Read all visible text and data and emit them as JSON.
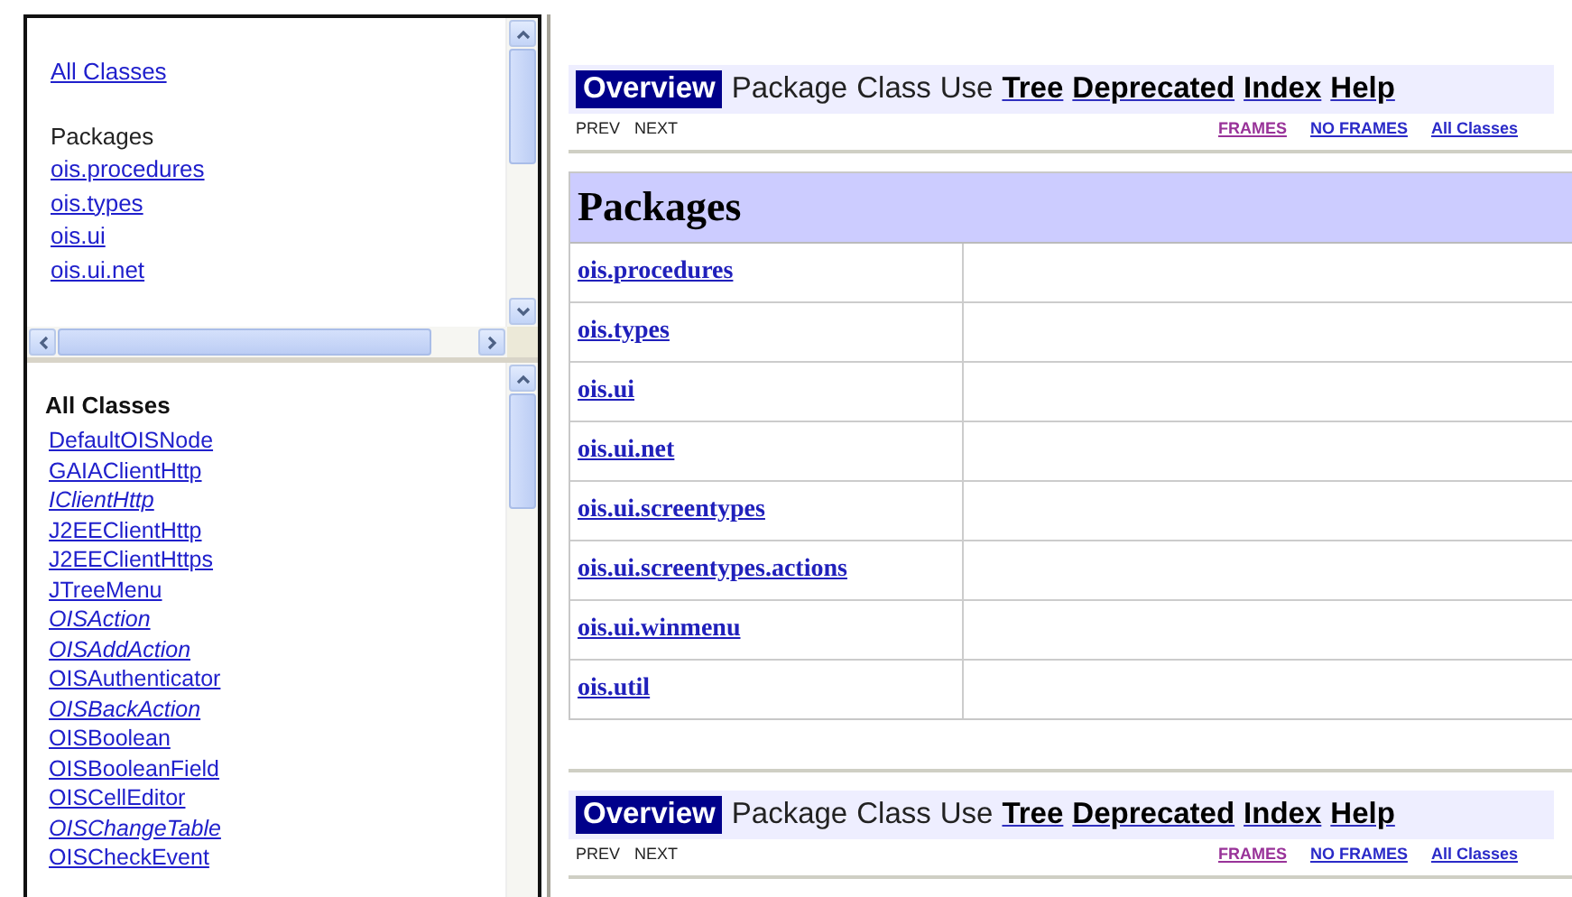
{
  "package_frame": {
    "all_classes_link": "All Classes",
    "packages_label": "Packages",
    "packages": [
      "ois.procedures",
      "ois.types",
      "ois.ui",
      "ois.ui.net"
    ]
  },
  "class_frame": {
    "heading": "All Classes",
    "classes": [
      {
        "name": "DefaultOISNode",
        "kind": "class"
      },
      {
        "name": "GAIAClientHttp",
        "kind": "class"
      },
      {
        "name": "IClientHttp",
        "kind": "interface"
      },
      {
        "name": "J2EEClientHttp",
        "kind": "class"
      },
      {
        "name": "J2EEClientHttps",
        "kind": "class"
      },
      {
        "name": "JTreeMenu",
        "kind": "class"
      },
      {
        "name": "OISAction",
        "kind": "interface"
      },
      {
        "name": "OISAddAction",
        "kind": "interface"
      },
      {
        "name": "OISAuthenticator",
        "kind": "class"
      },
      {
        "name": "OISBackAction",
        "kind": "interface"
      },
      {
        "name": "OISBoolean",
        "kind": "class"
      },
      {
        "name": "OISBooleanField",
        "kind": "class"
      },
      {
        "name": "OISCellEditor",
        "kind": "class"
      },
      {
        "name": "OISChangeTable",
        "kind": "interface"
      },
      {
        "name": "OISCheckEvent",
        "kind": "class"
      }
    ]
  },
  "top_navbar": {
    "items": [
      {
        "label": "Overview",
        "kind": "current"
      },
      {
        "label": "Package",
        "kind": "plain"
      },
      {
        "label": "Class",
        "kind": "plain"
      },
      {
        "label": "Use",
        "kind": "plain"
      },
      {
        "label": "Tree",
        "kind": "link"
      },
      {
        "label": "Deprecated",
        "kind": "link"
      },
      {
        "label": "Index",
        "kind": "link"
      },
      {
        "label": "Help",
        "kind": "link"
      }
    ],
    "subnav_left": [
      "PREV",
      "NEXT"
    ],
    "subnav_links": [
      {
        "label": "FRAMES",
        "visited": true
      },
      {
        "label": "NO FRAMES",
        "visited": false
      },
      {
        "label": "All Classes",
        "visited": false
      }
    ]
  },
  "packages_table": {
    "title": "Packages",
    "rows": [
      "ois.procedures",
      "ois.types",
      "ois.ui",
      "ois.ui.net",
      "ois.ui.screentypes",
      "ois.ui.screentypes.actions",
      "ois.ui.winmenu",
      "ois.util"
    ]
  },
  "bottom_navbar": {
    "items": [
      {
        "label": "Overview",
        "kind": "current"
      },
      {
        "label": "Package",
        "kind": "plain"
      },
      {
        "label": "Class",
        "kind": "plain"
      },
      {
        "label": "Use",
        "kind": "plain"
      },
      {
        "label": "Tree",
        "kind": "link"
      },
      {
        "label": "Deprecated",
        "kind": "link"
      },
      {
        "label": "Index",
        "kind": "link"
      },
      {
        "label": "Help",
        "kind": "link"
      }
    ],
    "subnav_left": [
      "PREV",
      "NEXT"
    ],
    "subnav_links": [
      {
        "label": "FRAMES",
        "visited": true
      },
      {
        "label": "NO FRAMES",
        "visited": false
      },
      {
        "label": "All Classes",
        "visited": false
      }
    ]
  }
}
